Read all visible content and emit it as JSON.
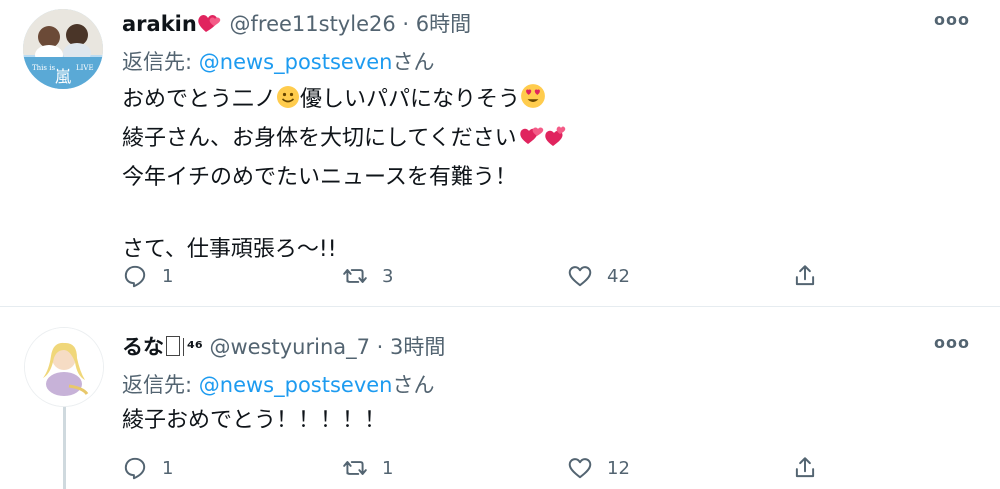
{
  "tweets": [
    {
      "name": "arakin",
      "handle": "@free11style26",
      "sep": "·",
      "time": "6時間",
      "reply_prefix": "返信先: ",
      "reply_to": "@news_postseven",
      "reply_suffix": "さん",
      "lines": [
        "おめでとう二ノ",
        "優しいパパになりそう",
        "綾子さん、お身体を大切にしてください",
        "今年イチのめでたいニュースを有難う！",
        "さて、仕事頑張ろ〜!!"
      ],
      "counts": {
        "replies": "1",
        "retweets": "3",
        "likes": "42"
      },
      "avatar_text": [
        "This is",
        "嵐",
        "LIVE"
      ]
    },
    {
      "name": "るな",
      "name_suffix": "⁴⁶",
      "handle": "@westyurina_7",
      "sep": "·",
      "time": "3時間",
      "reply_prefix": "返信先: ",
      "reply_to": "@news_postseven",
      "reply_suffix": "さん",
      "lines": [
        "綾子おめでとう！！！！！"
      ],
      "counts": {
        "replies": "1",
        "retweets": "1",
        "likes": "12"
      }
    }
  ],
  "icons": {
    "more": "more-horizontal-icon",
    "reply": "reply-bubble-icon",
    "retweet": "retweet-icon",
    "like": "heart-icon",
    "share": "share-icon",
    "emojis": [
      "heart-emoji",
      "smiling-face-emoji",
      "heart-eyes-emoji",
      "two-hearts-emoji"
    ]
  },
  "colors": {
    "mention": "#1d9bf0",
    "muted": "#536471",
    "heart": "#e0245e"
  }
}
